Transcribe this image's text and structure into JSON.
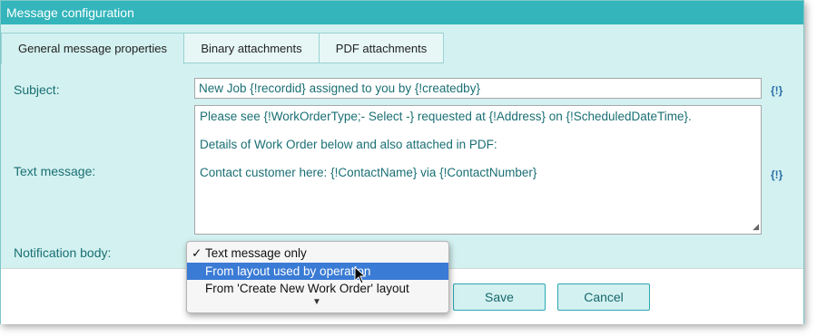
{
  "window": {
    "title": "Message configuration"
  },
  "tabs": [
    {
      "label": "General message properties",
      "active": true
    },
    {
      "label": "Binary attachments",
      "active": false
    },
    {
      "label": "PDF attachments",
      "active": false
    }
  ],
  "subject": {
    "label": "Subject:",
    "value": "New Job {!recordid} assigned to you by {!createdby}",
    "param_button": "{!}"
  },
  "text_message": {
    "label": "Text message:",
    "lines": [
      "Please see {!WorkOrderType;- Select -} requested at {!Address} on {!ScheduledDateTime}.",
      "Details of Work Order below and also attached in PDF:",
      "Contact customer here: {!ContactName} via {!ContactNumber}"
    ],
    "param_button": "{!}"
  },
  "notification_body": {
    "label": "Notification body:",
    "options": [
      "Text message only",
      "From layout used by operation",
      "From 'Create New Work Order' layout"
    ],
    "checked_option": "Text message only",
    "highlighted_option": "From layout used by operation",
    "check_glyph": "✓",
    "more_glyph": "▼"
  },
  "footer": {
    "save_label": "Save",
    "cancel_label": "Cancel"
  },
  "colors": {
    "titlebar": "#33b5bb",
    "panel": "#d3f1f0",
    "text": "#1a6f74",
    "highlight": "#3a7bd5"
  }
}
